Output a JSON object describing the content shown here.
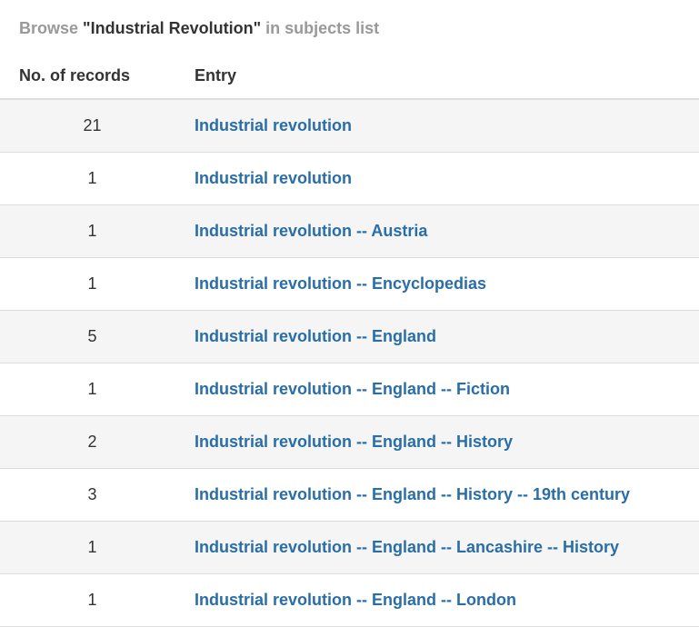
{
  "heading": {
    "prefix": "Browse",
    "term": "\"Industrial Revolution\"",
    "suffix": "in subjects list"
  },
  "table": {
    "headers": {
      "count": "No. of records",
      "entry": "Entry"
    },
    "rows": [
      {
        "count": "21",
        "entry": "Industrial revolution"
      },
      {
        "count": "1",
        "entry": "Industrial revolution"
      },
      {
        "count": "1",
        "entry": "Industrial revolution -- Austria"
      },
      {
        "count": "1",
        "entry": "Industrial revolution -- Encyclopedias"
      },
      {
        "count": "5",
        "entry": "Industrial revolution -- England"
      },
      {
        "count": "1",
        "entry": "Industrial revolution -- England -- Fiction"
      },
      {
        "count": "2",
        "entry": "Industrial revolution -- England -- History"
      },
      {
        "count": "3",
        "entry": "Industrial revolution -- England -- History -- 19th century"
      },
      {
        "count": "1",
        "entry": "Industrial revolution -- England -- Lancashire -- History"
      },
      {
        "count": "1",
        "entry": "Industrial revolution -- England -- London"
      }
    ]
  },
  "colors": {
    "link": "#2a6ea6",
    "muted": "#999999",
    "stripe": "#f5f5f5",
    "border": "#dddddd"
  }
}
